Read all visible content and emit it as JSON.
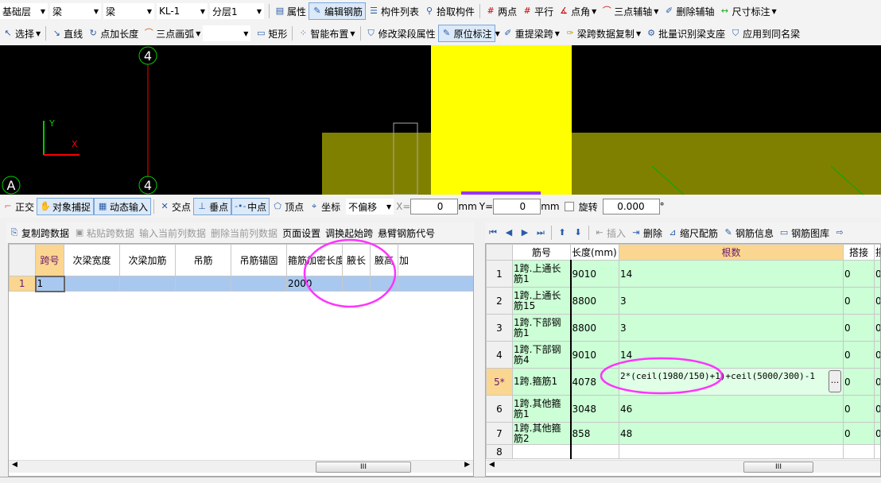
{
  "toolbar1": {
    "selects": [
      "基础层",
      "梁",
      "梁",
      "KL-1",
      "分层1"
    ],
    "buttons": [
      "属性",
      "编辑钢筋",
      "构件列表",
      "拾取构件",
      "两点",
      "平行",
      "点角",
      "三点辅轴",
      "删除辅轴",
      "尺寸标注"
    ]
  },
  "toolbar2": {
    "buttons": [
      "选择",
      "直线",
      "点加长度",
      "三点画弧",
      "矩形",
      "智能布置",
      "修改梁段属性",
      "原位标注",
      "重提梁跨",
      "梁跨数据复制",
      "批量识别梁支座",
      "应用到同名梁"
    ]
  },
  "canvas": {
    "axis_top": "4",
    "axis_bottom": "4",
    "axis_left": "A",
    "y_label": "Y",
    "x_label": "X",
    "colors": {
      "column": "#ffff00",
      "beam": "#808000",
      "axis": "#ff0000"
    }
  },
  "snapbar": {
    "buttons": [
      "正交",
      "对象捕捉",
      "动态输入",
      "交点",
      "垂点",
      "中点",
      "顶点",
      "坐标"
    ],
    "offset_select": "不偏移",
    "x_label": "X=",
    "x_value": "0",
    "x_unit": "mm",
    "y_label": "Y=",
    "y_value": "0",
    "y_unit": "mm",
    "rotate_label": "旋转",
    "rotate_value": "0.000",
    "degree": "°"
  },
  "left_panel": {
    "toolbar": [
      "复制跨数据",
      "粘贴跨数据",
      "输入当前列数据",
      "删除当前列数据",
      "页面设置",
      "调换起始跨",
      "悬臂钢筋代号"
    ],
    "columns": [
      "跨号",
      "次梁宽度",
      "次梁加筋",
      "吊筋",
      "吊筋锚固",
      "箍筋加密长度",
      "腋长",
      "腋高",
      "加"
    ],
    "rows": [
      {
        "num": "1",
        "cells": [
          "1",
          "",
          "",
          "",
          "",
          "2000",
          "",
          "",
          ""
        ]
      }
    ]
  },
  "right_panel": {
    "toolbar": [
      "插入",
      "删除",
      "缩尺配筋",
      "钢筋信息",
      "钢筋图库"
    ],
    "columns": [
      "筋号",
      "长度(mm)",
      "根数",
      "搭接",
      "损"
    ],
    "rows": [
      {
        "num": "1",
        "name": "1跨.上通长筋1",
        "length": "9010",
        "count": "14",
        "lap": "0",
        "x": "0"
      },
      {
        "num": "2",
        "name": "1跨.上通长筋15",
        "length": "8800",
        "count": "3",
        "lap": "0",
        "x": "0"
      },
      {
        "num": "3",
        "name": "1跨.下部钢筋1",
        "length": "8800",
        "count": "3",
        "lap": "0",
        "x": "0"
      },
      {
        "num": "4",
        "name": "1跨.下部钢筋4",
        "length": "9010",
        "count": "14",
        "lap": "0",
        "x": "0"
      },
      {
        "num": "5*",
        "name": "1跨.箍筋1",
        "length": "4078",
        "count": "2*(ceil(1980/150)+1)+ceil(5000/300)-1",
        "lap": "0",
        "x": "0"
      },
      {
        "num": "6",
        "name": "1跨.其他箍筋1",
        "length": "3048",
        "count": "46",
        "lap": "0",
        "x": "0"
      },
      {
        "num": "7",
        "name": "1跨.其他箍筋2",
        "length": "858",
        "count": "48",
        "lap": "0",
        "x": "0"
      }
    ],
    "empty_row": "8",
    "ellipsis": "..."
  },
  "highlight_color": "#ff33ff"
}
